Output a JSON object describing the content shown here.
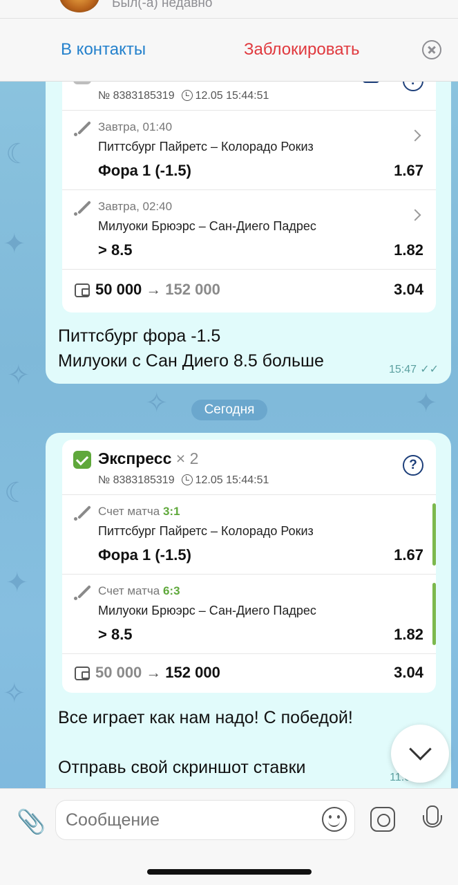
{
  "header": {
    "status": "Был(-а) недавно",
    "add_contact": "В контакты",
    "block": "Заблокировать"
  },
  "bet1": {
    "number": "№ 8383185319",
    "datetime": "12.05 15:44:51",
    "events": [
      {
        "time": "Завтра, 01:40",
        "teams": "Питтсбург Пайретс – Колорадо Рокиз",
        "market": "Фора 1 (-1.5)",
        "odd": "1.67"
      },
      {
        "time": "Завтра, 02:40",
        "teams": "Милуоки Брюэрс – Сан-Диего Падрес",
        "market": "> 8.5",
        "odd": "1.82"
      }
    ],
    "stake": "50 000",
    "payout": "152 000",
    "total_odd": "3.04",
    "caption_line1": "Питтсбург фора -1.5",
    "caption_line2": "Милуоки с Сан Диего 8.5 больше",
    "time": "15:47"
  },
  "date_separator": "Сегодня",
  "bet2": {
    "title": "Экспресс",
    "count": "× 2",
    "number": "№ 8383185319",
    "datetime": "12.05 15:44:51",
    "score_label": "Счет матча",
    "events": [
      {
        "score": "3:1",
        "teams": "Питтсбург Пайретс – Колорадо Рокиз",
        "market": "Фора 1 (-1.5)",
        "odd": "1.67"
      },
      {
        "score": "6:3",
        "teams": "Милуоки Брюэрс – Сан-Диего Падрес",
        "market": "> 8.5",
        "odd": "1.82"
      }
    ],
    "stake": "50 000",
    "payout": "152 000",
    "total_odd": "3.04",
    "caption_line1": "Все играет как нам надо! С победой!",
    "caption_line2": "Отправь свой скриншот ставки",
    "time": "11:06"
  },
  "input": {
    "placeholder": "Сообщение"
  },
  "colors": {
    "accent_blue": "#2481cc",
    "block_red": "#e0393e",
    "win_green": "#5fa83b",
    "bubble": "#e1fbfb"
  }
}
